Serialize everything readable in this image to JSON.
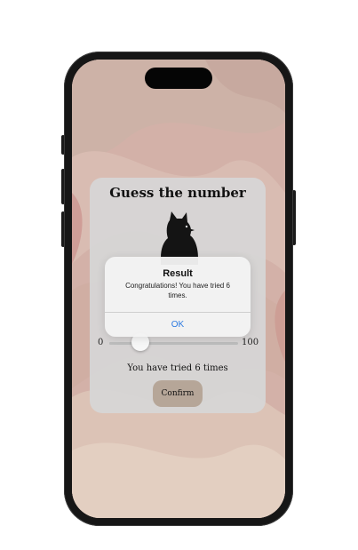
{
  "app": {
    "title": "Guess the number",
    "image_icon": "black-cat-silhouette-icon"
  },
  "slider": {
    "min_label": "0",
    "max_label": "100",
    "value_fraction": 0.24
  },
  "status_text": "You have tried 6 times",
  "confirm_label": "Confirm",
  "alert": {
    "title": "Result",
    "message": "Congratulations! You have tried 6 times.",
    "ok_label": "OK",
    "ok_color": "#2d7ae0"
  },
  "colors": {
    "card_bg": "#d6d6d6",
    "confirm_bg": "#b6a698",
    "wallpaper": "#d5b4ab"
  }
}
